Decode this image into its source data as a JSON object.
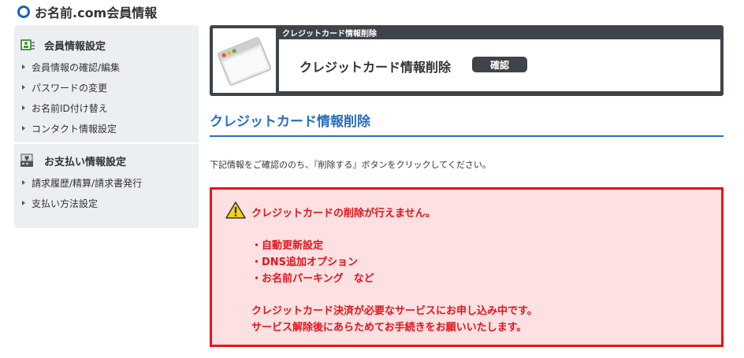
{
  "page": {
    "title": "お名前.com会員情報"
  },
  "sidebar": {
    "sections": [
      {
        "heading": "会員情報設定",
        "items": [
          "会員情報の確認/編集",
          "パスワードの変更",
          "お名前ID付け替え",
          "コンタクト情報設定"
        ]
      },
      {
        "heading": "お支払い情報設定",
        "items": [
          "請求履歴/精算/請求書発行",
          "支払い方法設定"
        ]
      }
    ]
  },
  "header": {
    "label": "クレジットカード情報削除",
    "title": "クレジットカード情報削除",
    "badge": "確認"
  },
  "section": {
    "title": "クレジットカード情報削除",
    "instruction": "下記情報をご確認ののち、『削除する』ボタンをクリックしてください。"
  },
  "alert": {
    "title": "クレジットカードの削除が行えません。",
    "items": [
      "・自動更新設定",
      "・DNS追加オプション",
      "・お名前パーキング　など"
    ],
    "message_1": "クレジットカード決済が必要なサービスにお申し込み中です。",
    "message_2": "サービス解除後にあらためてお手続きをお願いいたします。"
  },
  "colors": {
    "accent": "#2a6ec0",
    "alert_red": "#e2151c",
    "alert_bg": "#fde0e1",
    "header_dark": "#3e4449"
  }
}
